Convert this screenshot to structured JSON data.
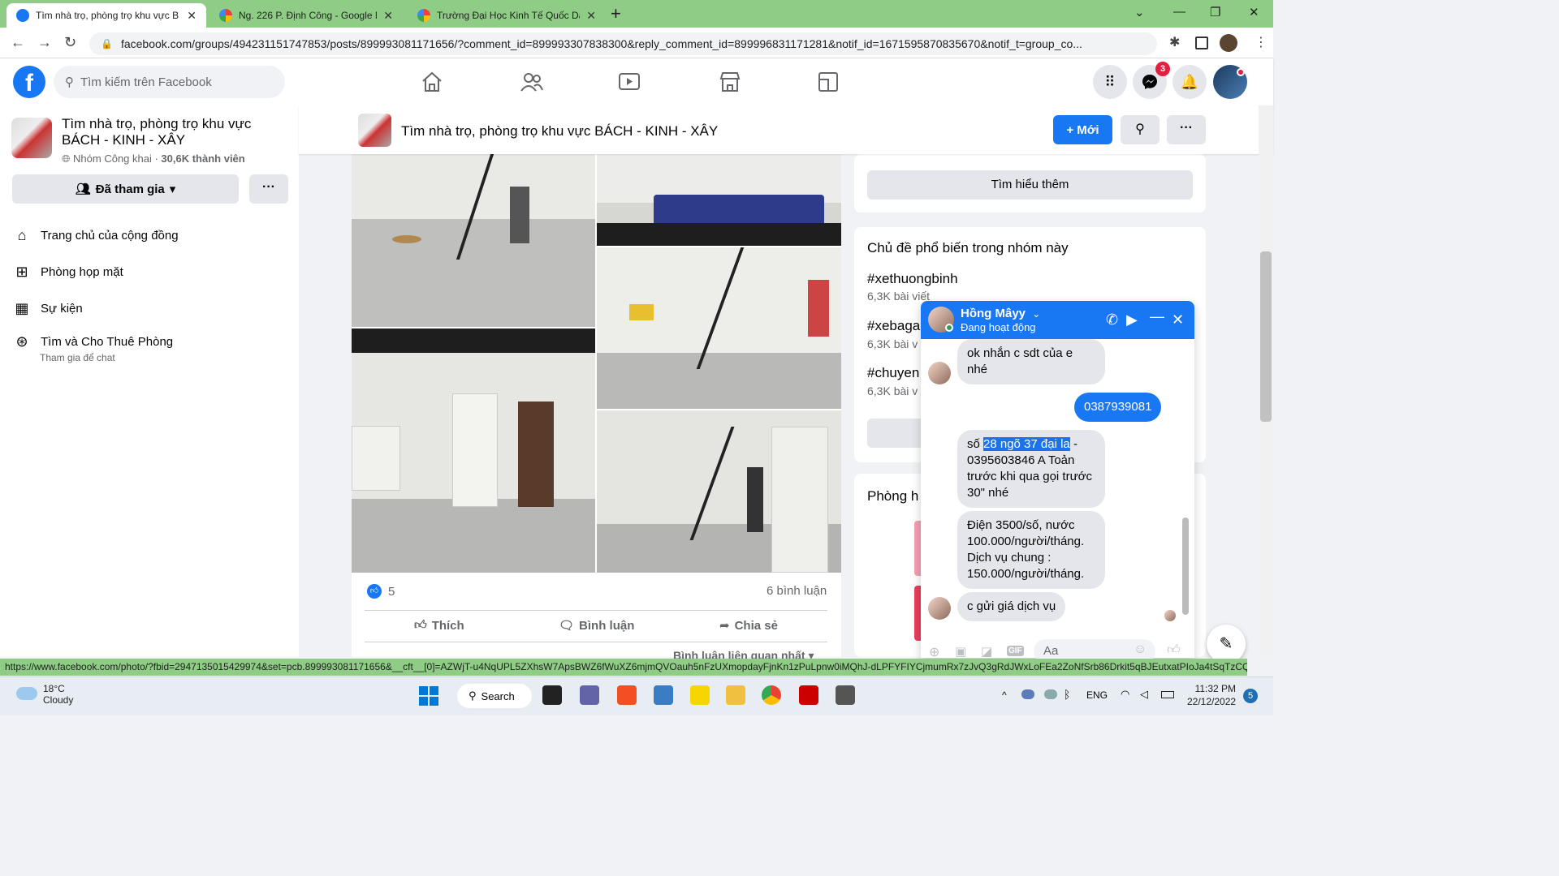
{
  "browser": {
    "tabs": [
      {
        "label": "Tìm nhà trọ, phòng trọ khu vực B",
        "active": true
      },
      {
        "label": "Ng. 226 P. Định Công - Google M",
        "active": false
      },
      {
        "label": "Trường Đại Học Kinh Tế Quốc Dâ",
        "active": false
      }
    ],
    "url": "facebook.com/groups/494231151747853/posts/899993081171656/?comment_id=899993307838300&reply_comment_id=899996831171281&notif_id=1671595870835670&notif_t=group_co...",
    "status_url": "https://www.facebook.com/photo/?fbid=2947135015429974&set=pcb.899993081171656&__cft__[0]=AZWjT-u4NqUPL5ZXhsW7ApsBWZ6fWuXZ6mjmQVOauh5nFzUXmopdayFjnKn1zPuLpnw0iMQhJ-dLPFYFIYCjmumRx7zJvQ3gRdJWxLoFEa2ZoNfSrb86Drkit5qBJEutxatPIoJa4tSqTzCQ..."
  },
  "fb": {
    "search_placeholder": "Tìm kiếm trên Facebook",
    "notif_count": "3"
  },
  "sidebar": {
    "group_name": "Tìm nhà trọ, phòng trọ khu vực BÁCH - KINH - XÂY",
    "group_meta": "Nhóm Công khai · ",
    "member_count": "30,6K thành viên",
    "joined_label": "Đã tham gia",
    "more": "···",
    "items": [
      {
        "label": "Trang chủ của cộng đồng"
      },
      {
        "label": "Phòng họp mặt"
      },
      {
        "label": "Sự kiện"
      },
      {
        "label": "Tìm và Cho Thuê Phòng",
        "sub": "Tham gia để chat"
      }
    ]
  },
  "group_header": {
    "title": "Tìm nhà trọ, phòng trọ khu vực BÁCH - KINH - XÂY",
    "new_label": "Mới",
    "more": "···"
  },
  "post": {
    "like_count": "5",
    "comment_count": "6 bình luận",
    "actions": [
      "Thích",
      "Bình luận",
      "Chia sẻ"
    ],
    "sort_label": "Bình luận liên quan nhất"
  },
  "right": {
    "learn_more": "Tìm hiểu thêm",
    "topics_heading": "Chủ đề phổ biến trong nhóm này",
    "topics": [
      {
        "tag": "#xethuongbinh",
        "count": "6,3K bài viết"
      },
      {
        "tag": "#xebaga",
        "count": "6,3K bài v"
      },
      {
        "tag": "#chuyen",
        "count": "6,3K bài v"
      }
    ],
    "rooms_heading": "Phòng h"
  },
  "chat": {
    "name": "Hồng Mâyy",
    "status": "Đang hoạt động",
    "messages": [
      {
        "dir": "in",
        "text": "ok nhắn c sdt của e nhé"
      },
      {
        "dir": "out",
        "text": "0387939081"
      },
      {
        "dir": "in",
        "pre": "số ",
        "highlight": "28 ngõ 37 đại la",
        "post": " - 0395603846 A Toản trước khi qua gọi trước 30\" nhé"
      },
      {
        "dir": "in",
        "text": "Điện 3500/số, nước 100.000/người/tháng. Dịch vụ chung : 150.000/người/tháng."
      },
      {
        "dir": "in",
        "text": "c gửi giá dịch vụ"
      }
    ],
    "input_placeholder": "Aa"
  },
  "taskbar": {
    "temp": "18°C",
    "weather": "Cloudy",
    "search_label": "Search",
    "lang": "ENG",
    "time": "11:32 PM",
    "date": "22/12/2022",
    "notif": "5"
  },
  "colors": {
    "fb_blue": "#1877f2",
    "chrome_green": "#8fcc86",
    "bg": "#f0f2f5"
  }
}
